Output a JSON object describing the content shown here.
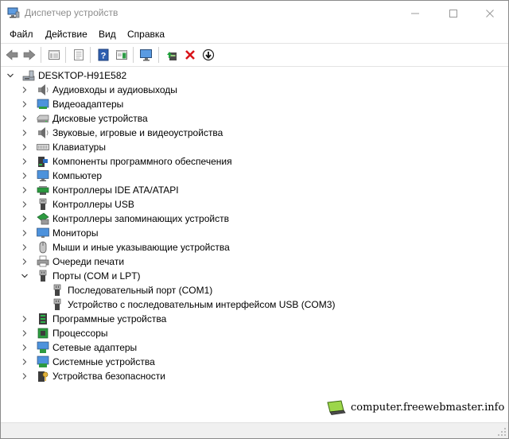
{
  "window": {
    "title": "Диспетчер устройств",
    "controls": {
      "minimize": "—",
      "maximize": "☐",
      "close": "✕"
    }
  },
  "menu": [
    {
      "label": "Файл"
    },
    {
      "label": "Действие"
    },
    {
      "label": "Вид"
    },
    {
      "label": "Справка"
    }
  ],
  "toolbar": {
    "buttons": [
      "back-icon",
      "forward-icon",
      "properties-list-icon",
      "page-icon",
      "help-icon",
      "view-panel-icon",
      "monitor-scan-icon",
      "update-driver-icon",
      "uninstall-icon",
      "download-driver-icon"
    ]
  },
  "tree": {
    "root": {
      "label": "DESKTOP-H91E582",
      "expanded": true
    },
    "items": [
      {
        "label": "Аудиовходы и аудиовыходы",
        "icon": "speaker-icon",
        "expanded": false
      },
      {
        "label": "Видеоадаптеры",
        "icon": "display-adapter-icon",
        "expanded": false
      },
      {
        "label": "Дисковые устройства",
        "icon": "disk-drive-icon",
        "expanded": false
      },
      {
        "label": "Звуковые, игровые и видеоустройства",
        "icon": "sound-icon",
        "expanded": false
      },
      {
        "label": "Клавиатуры",
        "icon": "keyboard-icon",
        "expanded": false
      },
      {
        "label": "Компоненты программного обеспечения",
        "icon": "software-component-icon",
        "expanded": false
      },
      {
        "label": "Компьютер",
        "icon": "computer-icon",
        "expanded": false
      },
      {
        "label": "Контроллеры IDE ATA/ATAPI",
        "icon": "ide-controller-icon",
        "expanded": false
      },
      {
        "label": "Контроллеры USB",
        "icon": "usb-controller-icon",
        "expanded": false
      },
      {
        "label": "Контроллеры запоминающих устройств",
        "icon": "storage-controller-icon",
        "expanded": false
      },
      {
        "label": "Мониторы",
        "icon": "monitor-icon",
        "expanded": false
      },
      {
        "label": "Мыши и иные указывающие устройства",
        "icon": "mouse-icon",
        "expanded": false
      },
      {
        "label": "Очереди печати",
        "icon": "printer-icon",
        "expanded": false
      },
      {
        "label": "Порты (COM и LPT)",
        "icon": "port-icon",
        "expanded": true,
        "children": [
          {
            "label": "Последовательный порт (COM1)",
            "icon": "port-icon"
          },
          {
            "label": "Устройство с последовательным интерфейсом USB (COM3)",
            "icon": "port-icon"
          }
        ]
      },
      {
        "label": "Программные устройства",
        "icon": "software-device-icon",
        "expanded": false
      },
      {
        "label": "Процессоры",
        "icon": "processor-icon",
        "expanded": false
      },
      {
        "label": "Сетевые адаптеры",
        "icon": "network-adapter-icon",
        "expanded": false
      },
      {
        "label": "Системные устройства",
        "icon": "system-device-icon",
        "expanded": false
      },
      {
        "label": "Устройства безопасности",
        "icon": "security-device-icon",
        "expanded": false
      }
    ]
  },
  "watermark": {
    "text": "computer.freewebmaster.info"
  },
  "colors": {
    "title_text": "#8d8d8d",
    "accent_blue": "#2b6cb5",
    "uninstall_red": "#d9141a",
    "update_green": "#1f9e3a"
  }
}
